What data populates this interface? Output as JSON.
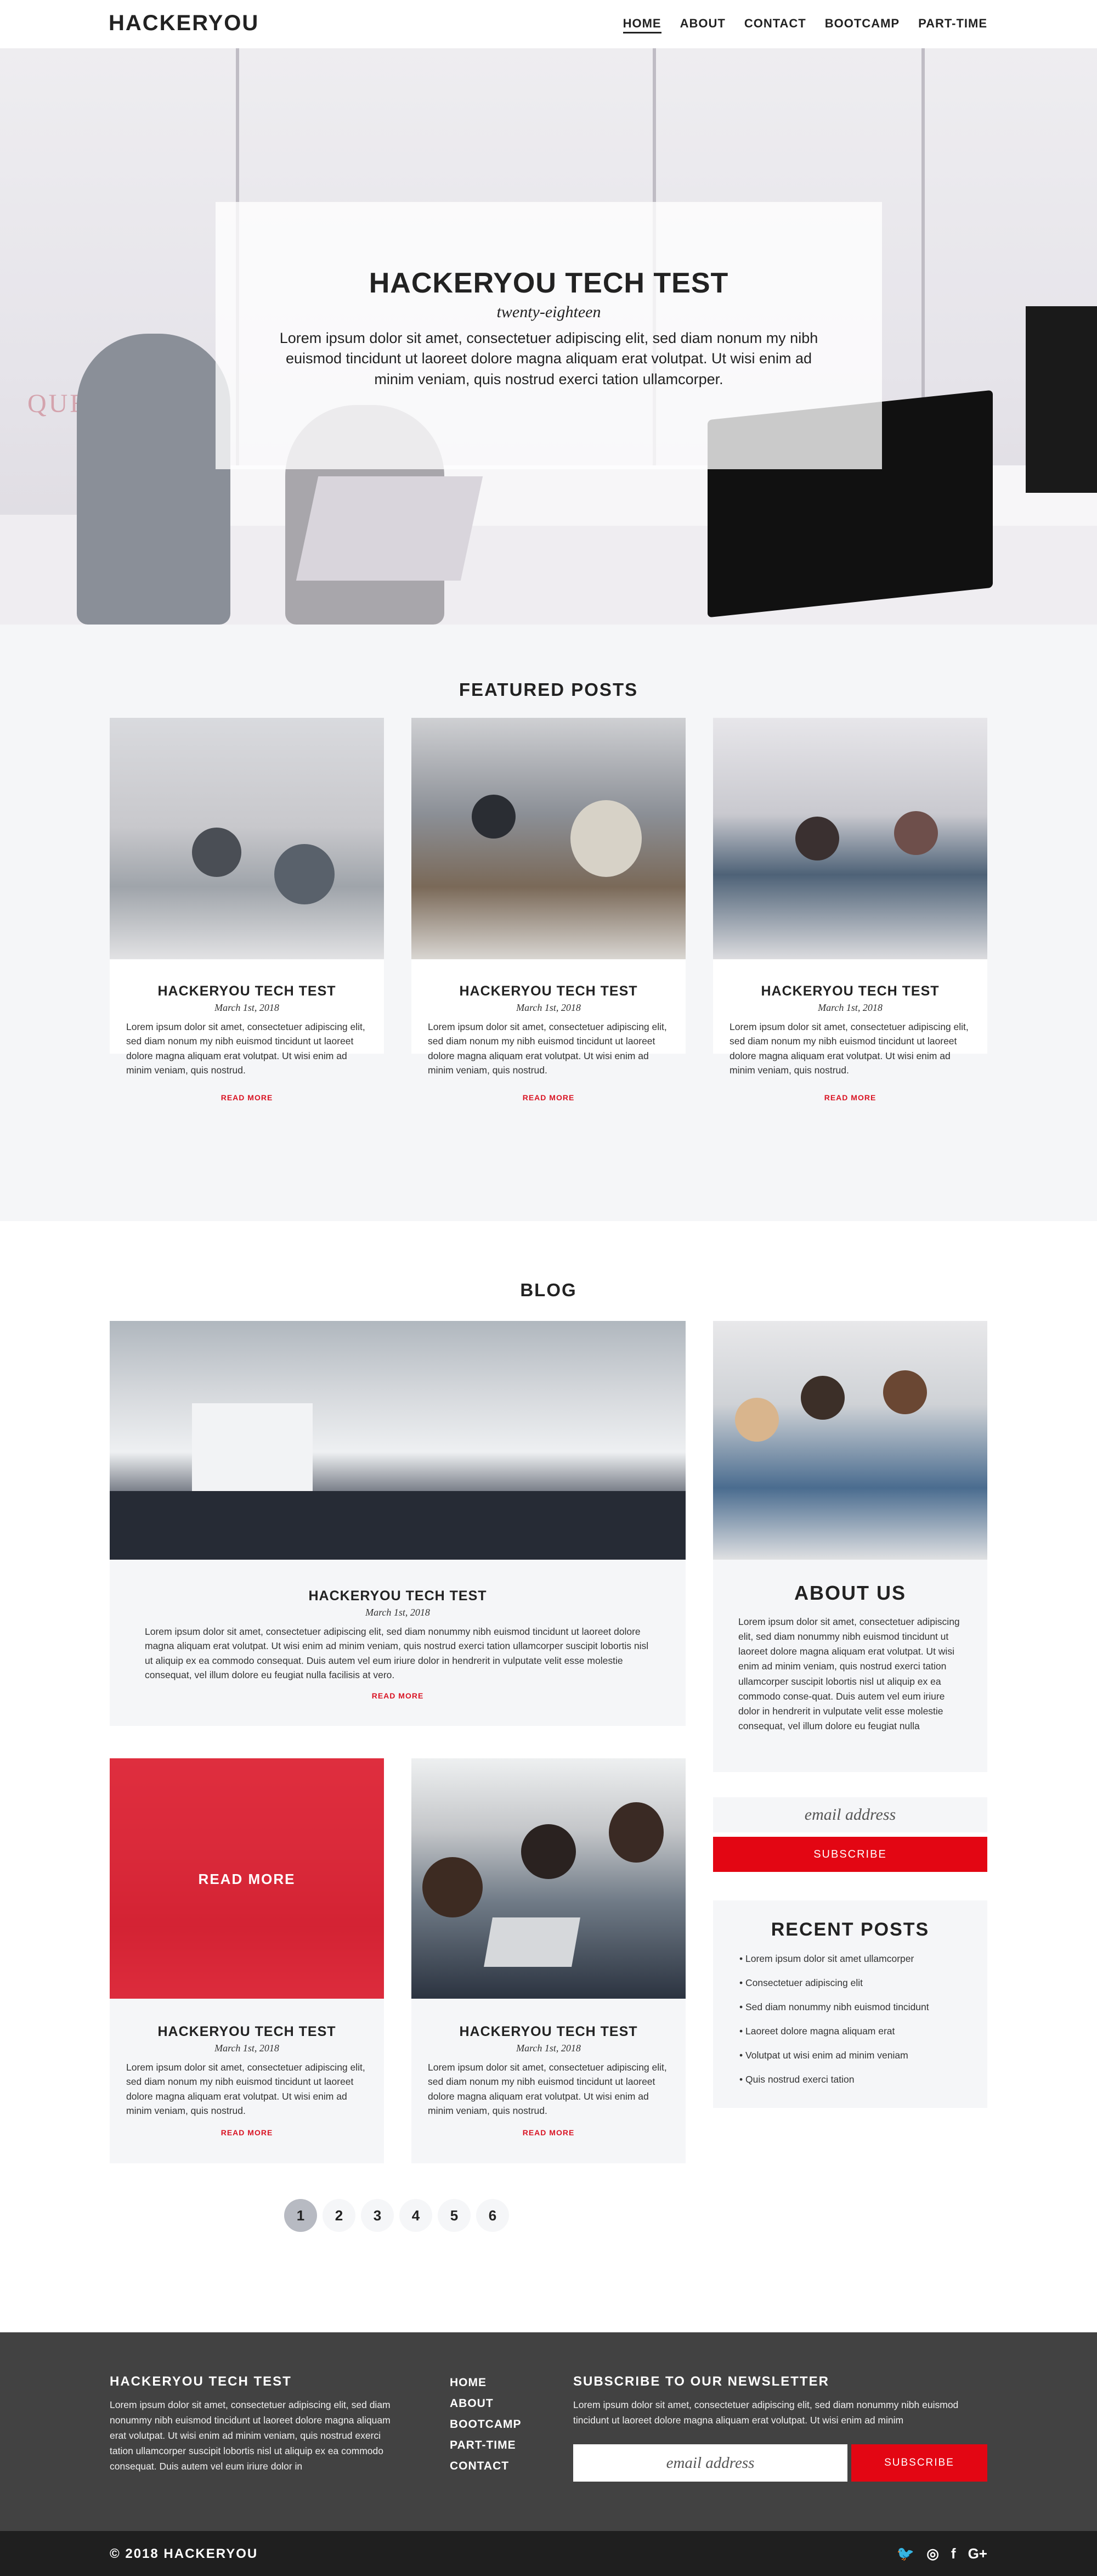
{
  "nav": {
    "brand": "HACKERYOU",
    "items": [
      "HOME",
      "ABOUT",
      "CONTACT",
      "BOOTCAMP",
      "PART-TIME"
    ],
    "active": "HOME"
  },
  "hero": {
    "title": "HACKERYOU TECH TEST",
    "subtitle": "twenty-eighteen",
    "body": "Lorem ipsum dolor sit amet, consectetuer adipiscing elit, sed diam nonum my nibh euismod tincidunt ut laoreet dolore magna aliquam erat volutpat. Ut wisi enim ad minim veniam, quis nostrud exerci tation ullamcorper.",
    "sign_text": "QUEEN"
  },
  "featured": {
    "title": "FEATURED POSTS",
    "posts": [
      {
        "title": "HACKERYOU TECH TEST",
        "date": "March 1st, 2018",
        "excerpt": "Lorem ipsum dolor sit amet, consectetuer adipiscing elit, sed diam nonum my nibh euismod tincidunt ut laoreet dolore magna aliquam erat volutpat. Ut wisi enim ad minim veniam, quis nostrud.",
        "more": "READ MORE"
      },
      {
        "title": "HACKERYOU TECH TEST",
        "date": "March 1st, 2018",
        "excerpt": "Lorem ipsum dolor sit amet, consectetuer adipiscing elit, sed diam nonum my nibh euismod tincidunt ut laoreet dolore magna aliquam erat volutpat. Ut wisi enim ad minim veniam, quis nostrud.",
        "more": "READ MORE"
      },
      {
        "title": "HACKERYOU TECH TEST",
        "date": "March 1st, 2018",
        "excerpt": "Lorem ipsum dolor sit amet, consectetuer adipiscing elit, sed diam nonum my nibh euismod tincidunt ut laoreet dolore magna aliquam erat volutpat. Ut wisi enim ad minim veniam, quis nostrud.",
        "more": "READ MORE"
      }
    ]
  },
  "blog": {
    "title": "BLOG",
    "main": {
      "title": "HACKERYOU TECH TEST",
      "date": "March 1st, 2018",
      "excerpt": "Lorem ipsum dolor sit amet, consectetuer adipiscing elit, sed diam nonummy nibh euismod tincidunt ut laoreet dolore magna aliquam erat volutpat. Ut wisi enim ad minim veniam, quis nostrud exerci tation ullamcorper suscipit lobortis nisl ut aliquip ex ea commodo consequat. Duis autem vel eum iriure dolor in hendrerit in vulputate velit esse molestie consequat, vel illum dolore eu feugiat nulla facilisis at vero.",
      "more": "READ MORE"
    },
    "overlay_label": "READ MORE",
    "small_posts": [
      {
        "title": "HACKERYOU TECH TEST",
        "date": "March 1st, 2018",
        "excerpt": "Lorem ipsum dolor sit amet, consectetuer adipiscing elit, sed diam nonum my nibh euismod tincidunt ut laoreet dolore magna aliquam erat volutpat. Ut wisi enim ad minim veniam, quis nostrud.",
        "more": "READ MORE"
      },
      {
        "title": "HACKERYOU TECH TEST",
        "date": "March 1st, 2018",
        "excerpt": "Lorem ipsum dolor sit amet, consectetuer adipiscing elit, sed diam nonum my nibh euismod tincidunt ut laoreet dolore magna aliquam erat volutpat. Ut wisi enim ad minim veniam, quis nostrud.",
        "more": "READ MORE"
      }
    ],
    "pagination": [
      "1",
      "2",
      "3",
      "4",
      "5",
      "6"
    ],
    "current_page": "1"
  },
  "sidebar": {
    "about_title": "ABOUT US",
    "about_text": "Lorem ipsum dolor sit amet, consectetuer adipiscing elit, sed diam nonummy nibh euismod tincidunt ut laoreet dolore magna aliquam erat volutpat. Ut wisi enim ad minim veniam, quis nostrud exerci tation ullamcorper suscipit lobortis nisl ut aliquip ex ea commodo conse-quat. Duis autem vel eum iriure dolor in hendrerit in vulputate velit esse molestie consequat, vel illum dolore eu feugiat nulla",
    "email_placeholder": "email address",
    "subscribe_label": "SUBSCRIBE",
    "recent_title": "RECENT POSTS",
    "recent_items": [
      "Lorem ipsum dolor sit amet ullamcorper",
      "Consectetuer adipiscing elit",
      "Sed diam nonummy nibh euismod tincidunt",
      "Laoreet dolore magna aliquam erat",
      "Volutpat ut wisi enim ad minim veniam",
      "Quis nostrud exerci tation"
    ]
  },
  "footer": {
    "about_title": "HACKERYOU TECH TEST",
    "about_text": "Lorem ipsum dolor sit amet, consectetuer adipiscing elit, sed diam nonummy nibh euismod tincidunt ut laoreet dolore magna aliquam erat volutpat. Ut wisi enim ad minim veniam, quis nostrud exerci tation ullamcorper suscipit lobortis nisl ut aliquip ex ea commodo consequat. Duis autem vel eum iriure dolor in",
    "links": [
      "HOME",
      "ABOUT",
      "BOOTCAMP",
      "PART-TIME",
      "CONTACT"
    ],
    "newsletter_title": "SUBSCRIBE TO OUR NEWSLETTER",
    "newsletter_text": "Lorem ipsum dolor sit amet, consectetuer adipiscing elit, sed diam nonummy nibh euismod tincidunt ut laoreet dolore magna aliquam erat volutpat. Ut wisi enim ad minim",
    "email_placeholder": "email address",
    "subscribe_label": "SUBSCRIBE",
    "copyright": "© 2018 HACKERYOU",
    "socials": [
      "twitter-icon",
      "instagram-icon",
      "facebook-icon",
      "google-plus-icon"
    ],
    "social_glyphs": [
      "🐦",
      "◎",
      "f",
      "G+"
    ]
  },
  "colors": {
    "accent": "#e30613",
    "footer_bg": "#424242",
    "bottom_bar": "#1f1f1f",
    "section_bg": "#f5f6f8"
  }
}
